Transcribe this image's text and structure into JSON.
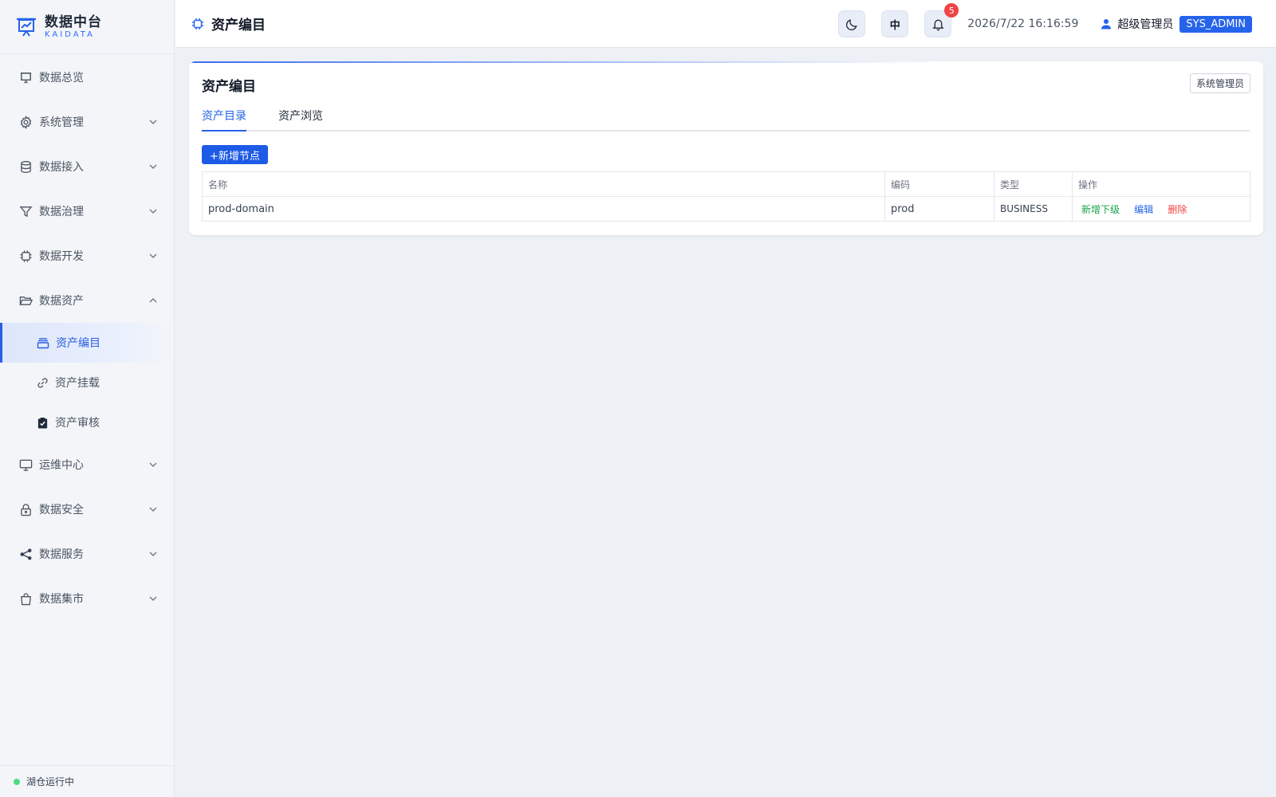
{
  "brand": {
    "title": "数据中台",
    "subtitle": "KAIDATA"
  },
  "sidebar": {
    "items": [
      {
        "label": "数据总览",
        "icon": "presentation-icon"
      },
      {
        "label": "系统管理",
        "icon": "gear-icon"
      },
      {
        "label": "数据接入",
        "icon": "database-icon"
      },
      {
        "label": "数据治理",
        "icon": "filter-icon"
      },
      {
        "label": "数据开发",
        "icon": "chip-icon"
      },
      {
        "label": "数据资产",
        "icon": "folder-icon",
        "expanded": true,
        "children": [
          {
            "label": "资产编目",
            "icon": "catalog-icon",
            "active": true
          },
          {
            "label": "资产挂载",
            "icon": "link-icon"
          },
          {
            "label": "资产审核",
            "icon": "clipboard-check-icon"
          }
        ]
      },
      {
        "label": "运维中心",
        "icon": "monitor-icon"
      },
      {
        "label": "数据安全",
        "icon": "lock-icon"
      },
      {
        "label": "数据服务",
        "icon": "share-icon"
      },
      {
        "label": "数据集市",
        "icon": "shopping-bag-icon"
      }
    ],
    "status": "湖仓运行中"
  },
  "header": {
    "title": "资产编目",
    "lang": "中",
    "notifications": "5",
    "datetime": "2026/7/22 16:16:59",
    "user": "超级管理员",
    "role": "SYS_ADMIN"
  },
  "card": {
    "title": "资产编目",
    "tag": "系统管理员",
    "tabs": [
      {
        "label": "资产目录",
        "active": true
      },
      {
        "label": "资产浏览"
      }
    ],
    "add_button": "+新增节点",
    "table": {
      "columns": [
        "名称",
        "编码",
        "类型",
        "操作"
      ],
      "rows": [
        {
          "name": "prod-domain",
          "code": "prod",
          "type": "BUSINESS",
          "actions": {
            "add_child": "新增下级",
            "edit": "编辑",
            "delete": "删除"
          }
        }
      ]
    }
  },
  "colors": {
    "accent": "#2563eb",
    "success": "#16a34a",
    "danger": "#ef4444"
  }
}
